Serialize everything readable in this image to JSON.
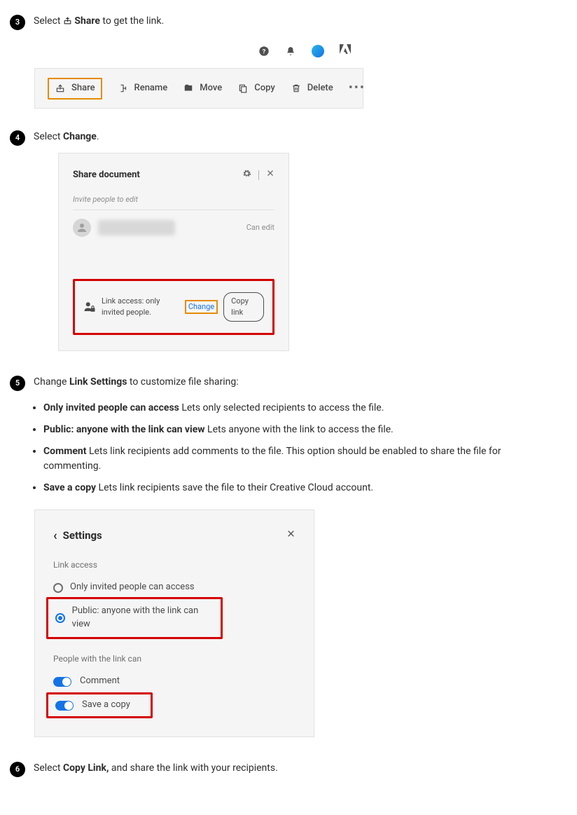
{
  "step3": {
    "num": "3",
    "text_a": "Select ",
    "text_b": " Share",
    "text_c": " to get the link.",
    "toolbar": {
      "share": "Share",
      "rename": "Rename",
      "move": "Move",
      "copy": "Copy",
      "delete": "Delete"
    }
  },
  "step4": {
    "num": "4",
    "text_a": "Select ",
    "text_b": "Change",
    "text_c": ".",
    "title": "Share document",
    "invite": "Invite people to edit",
    "can_edit": "Can edit",
    "link_access": "Link access: only invited people.",
    "change": "Change",
    "copy_link": "Copy link"
  },
  "step5": {
    "num": "5",
    "text_a": "Change ",
    "text_b": "Link Settings",
    "text_c": " to customize file sharing:",
    "opts": [
      {
        "b": "Only invited people can access",
        "t": " Lets only selected recipients to access the file."
      },
      {
        "b": "Public: anyone with the link can view",
        "t": " Lets anyone with the link to access the file."
      },
      {
        "b": "Comment",
        "t": " Lets link recipients add comments to the file. This option should be enabled to share the file for commenting."
      },
      {
        "b": "Save a copy",
        "t": " Lets link recipients save the file to their Creative Cloud account."
      }
    ],
    "settings": {
      "title": "Settings",
      "section1": "Link access",
      "radio1": "Only invited people can access",
      "radio2": "Public: anyone with the link can view",
      "section2": "People with the link can",
      "toggle1": "Comment",
      "toggle2": "Save a copy"
    }
  },
  "step6": {
    "num": "6",
    "text_a": "Select ",
    "text_b": "Copy Link,",
    "text_c": " and share the link with your recipients."
  }
}
